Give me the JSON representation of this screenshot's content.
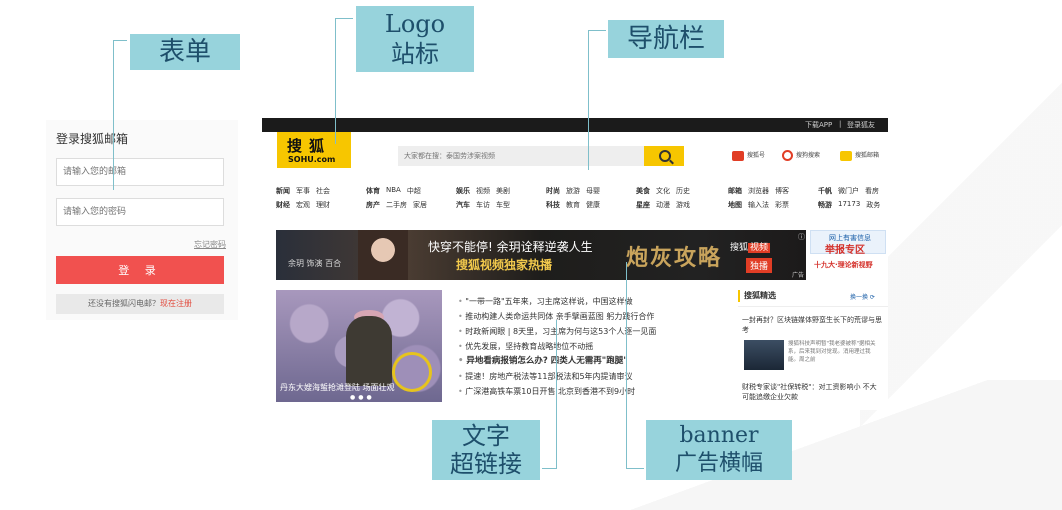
{
  "callouts": {
    "form": "表单",
    "logo_line1": "Logo",
    "logo_line2": "站标",
    "nav": "导航栏",
    "text_line1": "文字",
    "text_line2": "超链接",
    "banner_line1": "banner",
    "banner_line2": "广告横幅"
  },
  "login": {
    "title": "登录搜狐邮箱",
    "email_placeholder": "请输入您的邮箱",
    "password_placeholder": "请输入您的密码",
    "forgot": "忘记密码",
    "submit": "登 录",
    "register_prompt": "还没有搜狐闪电邮？",
    "register_link": "现在注册"
  },
  "sohu": {
    "topbar": {
      "app": "下载APP",
      "sep": "|",
      "login": "登录狐友"
    },
    "logo": {
      "main": "搜狐",
      "sub": "SOHU.com"
    },
    "search": {
      "placeholder": "大家都在搜：泰国劳涉案视频"
    },
    "quick": [
      "搜狐号",
      "搜狗搜索",
      "搜狐邮箱"
    ],
    "nav": [
      {
        "row1": [
          "新闻",
          "军事",
          "社会"
        ],
        "row2": [
          "财经",
          "宏观",
          "理财"
        ]
      },
      {
        "row1": [
          "体育",
          "NBA",
          "中超"
        ],
        "row2": [
          "房产",
          "二手房",
          "家居"
        ]
      },
      {
        "row1": [
          "娱乐",
          "视频",
          "美剧"
        ],
        "row2": [
          "汽车",
          "车访",
          "车型"
        ]
      },
      {
        "row1": [
          "时尚",
          "旅游",
          "母婴"
        ],
        "row2": [
          "科技",
          "教育",
          "健康"
        ]
      },
      {
        "row1": [
          "美食",
          "文化",
          "历史"
        ],
        "row2": [
          "星座",
          "动漫",
          "游戏"
        ]
      },
      {
        "row1": [
          "邮箱",
          "浏览器",
          "博客"
        ],
        "row2": [
          "地图",
          "输入法",
          "彩票"
        ]
      },
      {
        "row1": [
          "千帆",
          "微门户",
          "看房"
        ],
        "row2": [
          "畅游",
          "17173",
          "政务"
        ]
      }
    ],
    "banner": {
      "left_caption": "余玥 饰演 百合",
      "title": "快穿不能停! 余玥诠释逆袭人生",
      "subtitle": "搜狐视频独家热播",
      "show": "炮灰攻略",
      "brand": "搜狐",
      "brand_tag": "视频",
      "exclusive": "独播",
      "ad": "广告",
      "info": "ⓘ"
    },
    "side_ad": {
      "top": "网上有害信息",
      "main": "举报专区",
      "sub": "十九大·理论新视野"
    },
    "photo": {
      "caption": "丹东大嫂海蜇抢滩登陆 场面壮观",
      "dots": "●●●"
    },
    "news": [
      {
        "text": "\"一带一路\"五年来，习主席这样说，中国这样做",
        "bold": false
      },
      {
        "text": "推动构建人类命运共同体  亲手擘画蓝图 躬力践行合作",
        "bold": false
      },
      {
        "text": "时政新闻眼 | 8天里，习主席为何与这53个人逐一见面",
        "bold": false
      },
      {
        "text": "优先发展，坚持教育战略地位不动摇",
        "bold": false
      },
      {
        "text": "异地看病报销怎么办? 四类人无需再\"跑腿\"",
        "bold": true
      },
      {
        "text": "提速！房地产税法等11部税法和5年内提请审议",
        "bold": false
      },
      {
        "text": "广深港高铁车票10日开售 北京到香港不到9小时",
        "bold": false
      }
    ],
    "side": {
      "title": "搜狐精选",
      "more": "换一换 ⟳",
      "t1": "一封再封？区块链媒体野蛮生长下的荒谬与思考",
      "desc": "搜狐科技声明暂\"我老婆被称\"据相关系，后来我到对觉现。消用理过我能。周之前",
      "t2": "财税专家谈\"社保转税\"：对工资影响小 不大可能追缴企业欠款"
    },
    "colors": {
      "accent": "#f7c600",
      "topbar": "#1b1b1b",
      "login_button": "#f1514f",
      "callout": "#97d3dc"
    }
  }
}
